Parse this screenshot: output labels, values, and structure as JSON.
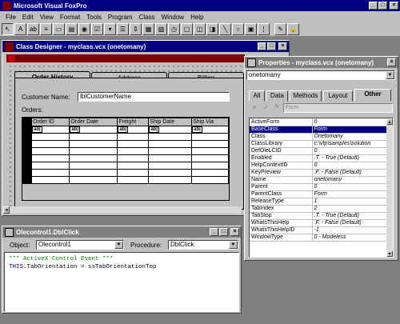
{
  "app": {
    "title": "Microsoft Visual FoxPro",
    "menu": [
      "File",
      "Edit",
      "View",
      "Format",
      "Tools",
      "Program",
      "Class",
      "Window",
      "Help"
    ]
  },
  "toolbar": {
    "buttons": [
      "select-pointer",
      "label",
      "textbox",
      "editbox",
      "command-button",
      "command-group",
      "option-group",
      "checkbox",
      "combobox",
      "listbox",
      "spinner",
      "grid",
      "image",
      "timer",
      "pageframe",
      "ole-container",
      "ole-bound",
      "line",
      "shape",
      "container",
      "separator",
      "builder-lock",
      "button-lock"
    ]
  },
  "class_designer": {
    "title": "Class Designer - myclass.vcx (onetomany)",
    "tabs": [
      "Order History",
      "Address",
      "Billing"
    ],
    "customer_label": "Customer Name:",
    "customer_value": "lblCustomerName",
    "orders_label": "Orders:",
    "grid_columns": [
      "Order ID",
      "Order Date",
      "Freight",
      "Ship Date",
      "Ship Via"
    ],
    "ab_glyph": "ab|"
  },
  "properties": {
    "title": "Properties - myclass.vcx (onetomany)",
    "object": "onetomany",
    "tabs": [
      "All",
      "Data",
      "Methods",
      "Layout",
      "Other"
    ],
    "edit_value": "Form",
    "rows": [
      {
        "name": "ActiveForm",
        "value": "0"
      },
      {
        "name": "BaseClass",
        "value": "Form"
      },
      {
        "name": "Class",
        "value": "Onetomany"
      },
      {
        "name": "ClassLibrary",
        "value": "c:\\vfp\\samples\\solution"
      },
      {
        "name": "DefOleLCID",
        "value": "0"
      },
      {
        "name": "Enabled",
        "value": ".T. - True (Default)"
      },
      {
        "name": "HelpContextID",
        "value": "0"
      },
      {
        "name": "KeyPreview",
        "value": ".F. - False (Default)"
      },
      {
        "name": "Name",
        "value": "onetomany"
      },
      {
        "name": "Parent",
        "value": "0"
      },
      {
        "name": "ParentClass",
        "value": "Form"
      },
      {
        "name": "ReleaseType",
        "value": "1"
      },
      {
        "name": "TabIndex",
        "value": "2"
      },
      {
        "name": "TabStop",
        "value": ".T. - True (Default)"
      },
      {
        "name": "WhatsThisHelp",
        "value": ".F. - False (Default)"
      },
      {
        "name": "WhatsThisHelpID",
        "value": "-1"
      },
      {
        "name": "WindowType",
        "value": "0 - Modeless"
      }
    ],
    "selected_row": "BaseClass"
  },
  "code_window": {
    "title": "Olecontrol1.DblClick",
    "object_label": "Object:",
    "object_value": "Olecontrol1",
    "procedure_label": "Procedure:",
    "procedure_value": "DblClick",
    "line1": "*** ActiveX Control Event ***",
    "line2_kw": "THIS",
    "line2_rest": ".TabOrientation = ssTabOrientationTop"
  },
  "colors": {
    "titlebar": "#000080",
    "desktop": "#808080",
    "face": "#c0c0c0"
  }
}
